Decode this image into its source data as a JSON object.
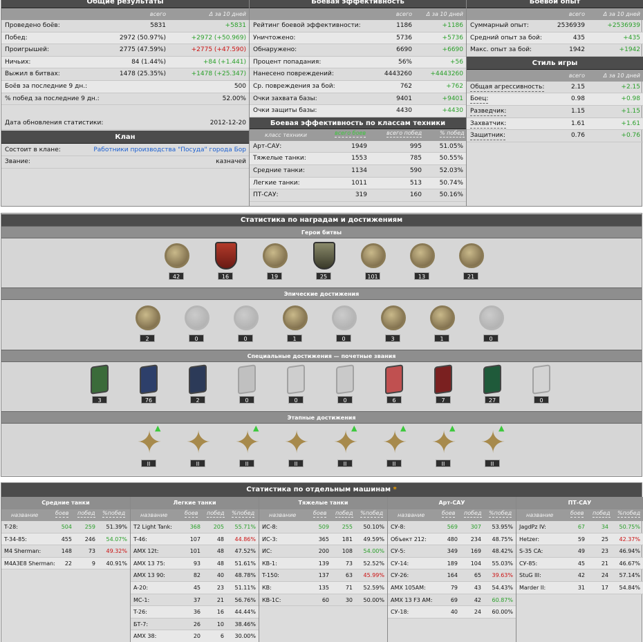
{
  "overall": {
    "title": "Общие результаты",
    "col_total": "всего",
    "col_delta": "Δ за 10 дней",
    "rows": [
      {
        "label": "Проведено боёв:",
        "total": "5831",
        "delta": "+5831",
        "dc": "g"
      },
      {
        "label": "Побед:",
        "total": "2972 (50.97%)",
        "delta": "+2972 (+50.969)",
        "dc": "g"
      },
      {
        "label": "Проигрышей:",
        "total": "2775 (47.59%)",
        "delta": "+2775 (+47.590)",
        "dc": "rd"
      },
      {
        "label": "Ничьих:",
        "total": "84 (1.44%)",
        "delta": "+84 (+1.441)",
        "dc": "g"
      },
      {
        "label": "Выжил в битвах:",
        "total": "1478 (25.35%)",
        "delta": "+1478 (+25.347)",
        "dc": "g"
      },
      {
        "label": "Боёв за последние 9 дн.:",
        "total": "",
        "delta": "500",
        "dc": ""
      },
      {
        "label": "% побед за последние 9 дн.:",
        "total": "",
        "delta": "52.00%",
        "dc": ""
      }
    ],
    "update_label": "Дата обновления статистики:",
    "update_value": "2012-12-20"
  },
  "clan": {
    "title": "Клан",
    "member_label": "Состоит в клане:",
    "member_value": "Работники производства \"Посуда\" города Бор",
    "rank_label": "Звание:",
    "rank_value": "казначей"
  },
  "battle_eff": {
    "title": "Боевая эффективность",
    "col_total": "всего",
    "col_delta": "Δ за 10 дней",
    "rows": [
      {
        "label": "Рейтинг боевой эффективности:",
        "total": "1186",
        "delta": "+1186"
      },
      {
        "label": "Уничтожено:",
        "total": "5736",
        "delta": "+5736"
      },
      {
        "label": "Обнаружено:",
        "total": "6690",
        "delta": "+6690"
      },
      {
        "label": "Процент попадания:",
        "total": "56%",
        "delta": "+56"
      },
      {
        "label": "Нанесено повреждений:",
        "total": "4443260",
        "delta": "+4443260"
      },
      {
        "label": "Ср. повреждения за бой:",
        "total": "762",
        "delta": "+762"
      },
      {
        "label": "Очки захвата базы:",
        "total": "9401",
        "delta": "+9401"
      },
      {
        "label": "Очки защиты базы:",
        "total": "4430",
        "delta": "+4430"
      }
    ]
  },
  "class_eff": {
    "title": "Боевая эффективность по классам техники",
    "h_class": "класс техники",
    "h_battles": "всего боев",
    "h_wins": "всего побед",
    "h_pct": "% побед",
    "rows": [
      {
        "label": "Арт-САУ:",
        "battles": "1949",
        "wins": "995",
        "pct": "51.05%"
      },
      {
        "label": "Тяжелые танки:",
        "battles": "1553",
        "wins": "785",
        "pct": "50.55%"
      },
      {
        "label": "Средние танки:",
        "battles": "1134",
        "wins": "590",
        "pct": "52.03%"
      },
      {
        "label": "Легкие танки:",
        "battles": "1011",
        "wins": "513",
        "pct": "50.74%"
      },
      {
        "label": "ПТ-САУ:",
        "battles": "319",
        "wins": "160",
        "pct": "50.16%"
      }
    ]
  },
  "xp": {
    "title": "Боевой опыт",
    "col_total": "всего",
    "col_delta": "Δ за 10 дней",
    "rows": [
      {
        "label": "Суммарный опыт:",
        "total": "2536939",
        "delta": "+2536939"
      },
      {
        "label": "Средний опыт за бой:",
        "total": "435",
        "delta": "+435"
      },
      {
        "label": "Макс. опыт за бой:",
        "total": "1942",
        "delta": "+1942"
      }
    ]
  },
  "style": {
    "title": "Стиль игры",
    "col_total": "всего",
    "col_delta": "Δ за 10 дней",
    "rows": [
      {
        "label": "Общая агрессивность:",
        "total": "2.15",
        "delta": "+2.15"
      },
      {
        "label": "Боец:",
        "total": "0.98",
        "delta": "+0.98"
      },
      {
        "label": "Разведчик:",
        "total": "1.15",
        "delta": "+1.15"
      },
      {
        "label": "Захватчик:",
        "total": "1.61",
        "delta": "+1.61"
      },
      {
        "label": "Защитник:",
        "total": "0.76",
        "delta": "+0.76"
      }
    ]
  },
  "awards": {
    "title": "Статистика по наградам и достижениям",
    "heroes": {
      "title": "Герои битвы",
      "counts": [
        "42",
        "16",
        "19",
        "25",
        "101",
        "13",
        "21"
      ]
    },
    "epic": {
      "title": "Эпические достижения",
      "counts": [
        "2",
        "0",
        "0",
        "1",
        "0",
        "3",
        "1",
        "0"
      ]
    },
    "special": {
      "title": "Специальные достижения — почетные звания",
      "counts": [
        "3",
        "76",
        "2",
        "0",
        "0",
        "0",
        "6",
        "7",
        "27",
        "0"
      ]
    },
    "stage": {
      "title": "Этапные достижения",
      "counts": [
        "II",
        "II",
        "II",
        "II",
        "II",
        "II",
        "II",
        "II"
      ]
    }
  },
  "vehicles": {
    "title": "Статистика по отдельным машинам",
    "star": "*",
    "h_name": "название",
    "h_battles": "боев",
    "h_wins": "побед",
    "h_pct": "%побед",
    "groups": [
      {
        "title": "Средние танки",
        "rows": [
          {
            "n": "T-28:",
            "b": "504",
            "w": "259",
            "p": "51.39%",
            "bc": "g",
            "wc": "g",
            "pc": ""
          },
          {
            "n": "T-34-85:",
            "b": "455",
            "w": "246",
            "p": "54.07%",
            "bc": "",
            "wc": "",
            "pc": "g"
          },
          {
            "n": "M4 Sherman:",
            "b": "148",
            "w": "73",
            "p": "49.32%",
            "bc": "",
            "wc": "",
            "pc": "rd"
          },
          {
            "n": "M4A3E8 Sherman:",
            "b": "22",
            "w": "9",
            "p": "40.91%",
            "bc": "",
            "wc": "",
            "pc": ""
          }
        ]
      },
      {
        "title": "Легкие танки",
        "rows": [
          {
            "n": "T2 Light Tank:",
            "b": "368",
            "w": "205",
            "p": "55.71%",
            "bc": "g",
            "wc": "g",
            "pc": "g"
          },
          {
            "n": "T-46:",
            "b": "107",
            "w": "48",
            "p": "44.86%",
            "bc": "",
            "wc": "",
            "pc": "rd"
          },
          {
            "n": "AMX 12t:",
            "b": "101",
            "w": "48",
            "p": "47.52%",
            "bc": "",
            "wc": "",
            "pc": ""
          },
          {
            "n": "AMX 13 75:",
            "b": "93",
            "w": "48",
            "p": "51.61%",
            "bc": "",
            "wc": "",
            "pc": ""
          },
          {
            "n": "AMX 13 90:",
            "b": "82",
            "w": "40",
            "p": "48.78%",
            "bc": "",
            "wc": "",
            "pc": ""
          },
          {
            "n": "A-20:",
            "b": "45",
            "w": "23",
            "p": "51.11%",
            "bc": "",
            "wc": "",
            "pc": ""
          },
          {
            "n": "МС-1:",
            "b": "37",
            "w": "21",
            "p": "56.76%",
            "bc": "",
            "wc": "",
            "pc": ""
          },
          {
            "n": "T-26:",
            "b": "36",
            "w": "16",
            "p": "44.44%",
            "bc": "",
            "wc": "",
            "pc": ""
          },
          {
            "n": "БТ-7:",
            "b": "26",
            "w": "10",
            "p": "38.46%",
            "bc": "",
            "wc": "",
            "pc": ""
          },
          {
            "n": "AMX 38:",
            "b": "20",
            "w": "6",
            "p": "30.00%",
            "bc": "",
            "wc": "",
            "pc": ""
          }
        ]
      },
      {
        "title": "Тяжелые танки",
        "rows": [
          {
            "n": "ИС-8:",
            "b": "509",
            "w": "255",
            "p": "50.10%",
            "bc": "g",
            "wc": "g",
            "pc": ""
          },
          {
            "n": "ИС-3:",
            "b": "365",
            "w": "181",
            "p": "49.59%",
            "bc": "",
            "wc": "",
            "pc": ""
          },
          {
            "n": "ИС:",
            "b": "200",
            "w": "108",
            "p": "54.00%",
            "bc": "",
            "wc": "",
            "pc": "g"
          },
          {
            "n": "КВ-1:",
            "b": "139",
            "w": "73",
            "p": "52.52%",
            "bc": "",
            "wc": "",
            "pc": ""
          },
          {
            "n": "T-150:",
            "b": "137",
            "w": "63",
            "p": "45.99%",
            "bc": "",
            "wc": "",
            "pc": "rd"
          },
          {
            "n": "КВ:",
            "b": "135",
            "w": "71",
            "p": "52.59%",
            "bc": "",
            "wc": "",
            "pc": ""
          },
          {
            "n": "КВ-1С:",
            "b": "60",
            "w": "30",
            "p": "50.00%",
            "bc": "",
            "wc": "",
            "pc": ""
          }
        ]
      },
      {
        "title": "Арт-САУ",
        "rows": [
          {
            "n": "СУ-8:",
            "b": "569",
            "w": "307",
            "p": "53.95%",
            "bc": "g",
            "wc": "g",
            "pc": ""
          },
          {
            "n": "Объект 212:",
            "b": "480",
            "w": "234",
            "p": "48.75%",
            "bc": "",
            "wc": "",
            "pc": ""
          },
          {
            "n": "СУ-5:",
            "b": "349",
            "w": "169",
            "p": "48.42%",
            "bc": "",
            "wc": "",
            "pc": ""
          },
          {
            "n": "СУ-14:",
            "b": "189",
            "w": "104",
            "p": "55.03%",
            "bc": "",
            "wc": "",
            "pc": ""
          },
          {
            "n": "СУ-26:",
            "b": "164",
            "w": "65",
            "p": "39.63%",
            "bc": "",
            "wc": "",
            "pc": "rd"
          },
          {
            "n": "AMX 105AM:",
            "b": "79",
            "w": "43",
            "p": "54.43%",
            "bc": "",
            "wc": "",
            "pc": ""
          },
          {
            "n": "AMX 13 F3 AM:",
            "b": "69",
            "w": "42",
            "p": "60.87%",
            "bc": "",
            "wc": "",
            "pc": "g"
          },
          {
            "n": "СУ-18:",
            "b": "40",
            "w": "24",
            "p": "60.00%",
            "bc": "",
            "wc": "",
            "pc": ""
          }
        ]
      },
      {
        "title": "ПТ-САУ",
        "rows": [
          {
            "n": "JagdPz IV:",
            "b": "67",
            "w": "34",
            "p": "50.75%",
            "bc": "g",
            "wc": "g",
            "pc": "g"
          },
          {
            "n": "Hetzer:",
            "b": "59",
            "w": "25",
            "p": "42.37%",
            "bc": "",
            "wc": "",
            "pc": "rd"
          },
          {
            "n": "S-35 CA:",
            "b": "49",
            "w": "23",
            "p": "46.94%",
            "bc": "",
            "wc": "",
            "pc": ""
          },
          {
            "n": "СУ-85:",
            "b": "45",
            "w": "21",
            "p": "46.67%",
            "bc": "",
            "wc": "",
            "pc": ""
          },
          {
            "n": "StuG III:",
            "b": "42",
            "w": "24",
            "p": "57.14%",
            "bc": "",
            "wc": "",
            "pc": ""
          },
          {
            "n": "Marder II:",
            "b": "31",
            "w": "17",
            "p": "54.84%",
            "bc": "",
            "wc": "",
            "pc": ""
          }
        ]
      }
    ]
  }
}
